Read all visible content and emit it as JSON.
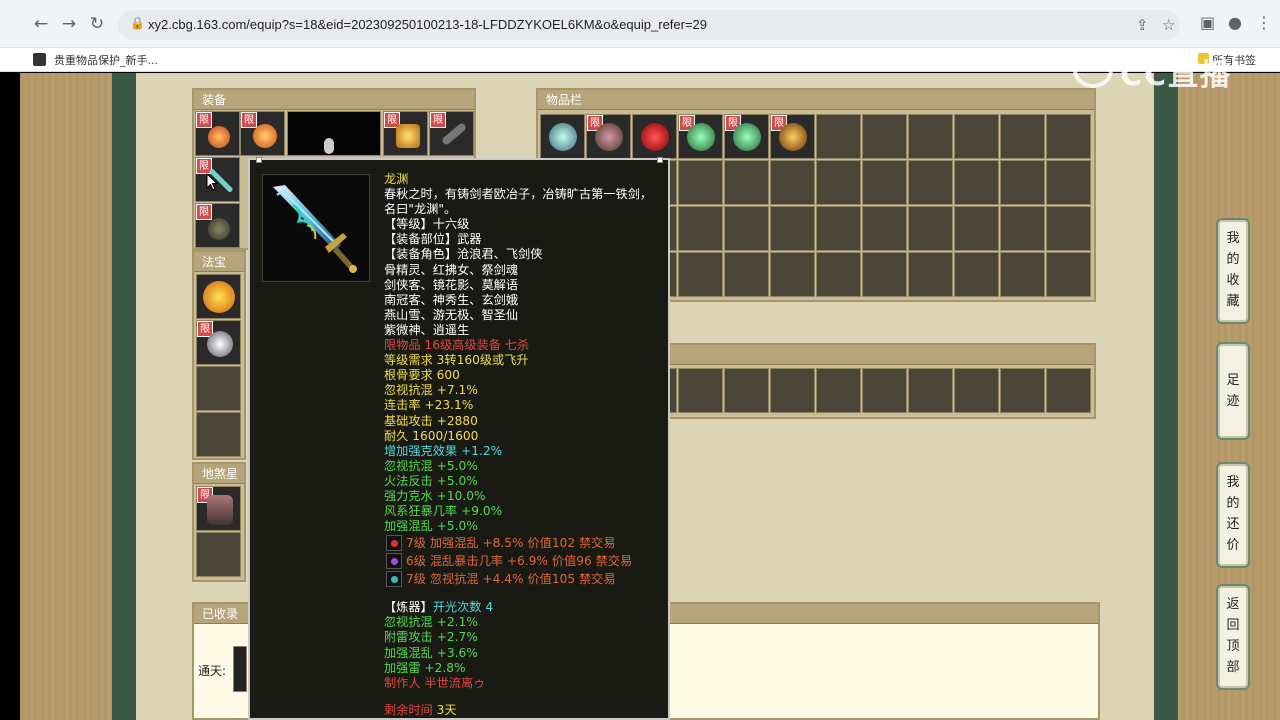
{
  "browser": {
    "url": "xy2.cbg.163.com/equip?s=18&eid=202309250100213-18-LFDDZYKOEL6KM&o&equip_refer=29",
    "bookmark": "贵重物品保护_新手...",
    "all_bookmarks": "所有书签"
  },
  "watermark": "CC直播",
  "panels": {
    "equip": "装备",
    "inventory": "物品栏",
    "fabao": "法宝",
    "disha": "地煞星",
    "collected": "已收录",
    "tongtian": "通天:"
  },
  "limit_badge": "限",
  "side_buttons": [
    {
      "label": "我的收藏",
      "chars": [
        "我",
        "的",
        "收",
        "藏"
      ]
    },
    {
      "label": "足迹",
      "chars": [
        "足",
        "迹"
      ]
    },
    {
      "label": "我的还价",
      "chars": [
        "我",
        "的",
        "还",
        "价"
      ]
    },
    {
      "label": "返回顶部",
      "chars": [
        "返",
        "回",
        "顶",
        "部"
      ]
    }
  ],
  "tooltip": {
    "name": "龙渊",
    "desc1": "春秋之时，有铸剑者欧冶子，冶铸旷古第一铁剑，",
    "desc2": "名曰\"龙渊\"。",
    "level": "【等级】十六级",
    "slot": "【装备部位】武器",
    "roles_head": "【装备角色】沧浪君、飞剑侠",
    "roles": [
      "骨精灵、红拂女、祭剑魂",
      "剑侠客、镜花影、莫解语",
      "南冠客、神秀生、玄剑娥",
      "燕山雪、游无极、智圣仙",
      "紫微神、逍遥生"
    ],
    "bind": "限物品 16级高级装备 七杀",
    "req_level": "等级需求 3转160级或飞升",
    "req_bone": "根骨要求 600",
    "base_attrs": [
      "忽视抗混 +7.1%",
      "连击率 +23.1%",
      "基础攻击 +2880",
      "耐久 1600/1600"
    ],
    "enhance": "增加强克效果 +1.2%",
    "extra_attrs": [
      "忽视抗混 +5.0%",
      "火法反击 +5.0%",
      "强力克水 +10.0%",
      "风系狂暴几率 +9.0%",
      "加强混乱 +5.0%"
    ],
    "gems": [
      {
        "text": "7级 加强混乱 +8.5% 价值102 禁交易",
        "color": "#e03030"
      },
      {
        "text": "6级 混乱暴击几率 +6.9% 价值96 禁交易",
        "color": "#a04ae0"
      },
      {
        "text": "7级 忽视抗混 +4.4% 价值105 禁交易",
        "color": "#30c0c0"
      }
    ],
    "refine_label": "【炼器】",
    "refine_count": "开光次数 4",
    "refine_attrs": [
      "忽视抗混 +2.1%",
      "附雷攻击 +2.7%",
      "加强混乱 +3.6%",
      "加强雷 +2.8%"
    ],
    "maker": "制作人 半世流离ゥ",
    "time_label": "剩余时间",
    "time_value": "3天"
  },
  "colors": {
    "page_bg": "#b99c6b",
    "content_bg": "#ddd3b5",
    "tooltip_bg": "#1a1a14",
    "limit_red": "#d14b4b"
  }
}
